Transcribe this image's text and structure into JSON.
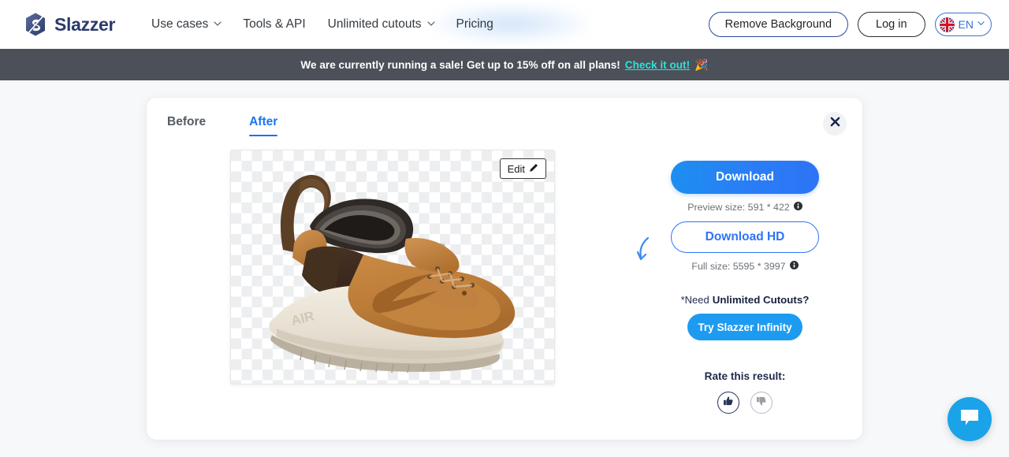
{
  "header": {
    "logo_text": "Slazzer",
    "logo_icon": "slazzer-hexagon-logo",
    "nav": [
      {
        "label": "Use cases",
        "has_chevron": true,
        "icon": "chevron-down-icon"
      },
      {
        "label": "Tools & API",
        "has_chevron": false
      },
      {
        "label": "Unlimited cutouts",
        "has_chevron": true,
        "icon": "chevron-down-icon"
      },
      {
        "label": "Pricing",
        "has_chevron": false
      }
    ],
    "remove_bg_label": "Remove Background",
    "login_label": "Log in",
    "language": {
      "code": "EN",
      "flag_icon": "uk-flag-icon",
      "chevron_icon": "chevron-down-icon"
    }
  },
  "banner": {
    "text": "We are currently running a sale! Get up to 15% off on all plans!",
    "link_label": "Check it out!",
    "emoji": "🎉",
    "bg_color": "#4b5059",
    "link_color": "#2fe0d8"
  },
  "card": {
    "tabs": [
      {
        "label": "Before",
        "active": false
      },
      {
        "label": "After",
        "active": true
      }
    ],
    "close_icon": "close-icon",
    "preview": {
      "edit_label": "Edit",
      "edit_icon": "pencil-icon",
      "image_subject": "brown-carhartt-nike-air-force-1-sneaker",
      "background": "transparency-checkerboard"
    },
    "actions": {
      "download_label": "Download",
      "preview_size_label": "Preview size: 591 * 422",
      "preview_info_icon": "info-icon",
      "download_hd_label": "Download HD",
      "full_size_label": "Full size: 5595 * 3997",
      "full_info_icon": "info-icon",
      "need_prefix": "*Need",
      "need_bold": "Unlimited Cutouts?",
      "arrow_icon": "curved-arrow-down-icon",
      "infinity_label": "Try Slazzer Infinity"
    },
    "rating": {
      "title": "Rate this result:",
      "thumbs_up_icon": "thumbs-up-icon",
      "thumbs_down_icon": "thumbs-down-icon"
    }
  },
  "chat": {
    "icon": "chat-bubble-icon",
    "color": "#1aa3e8"
  }
}
